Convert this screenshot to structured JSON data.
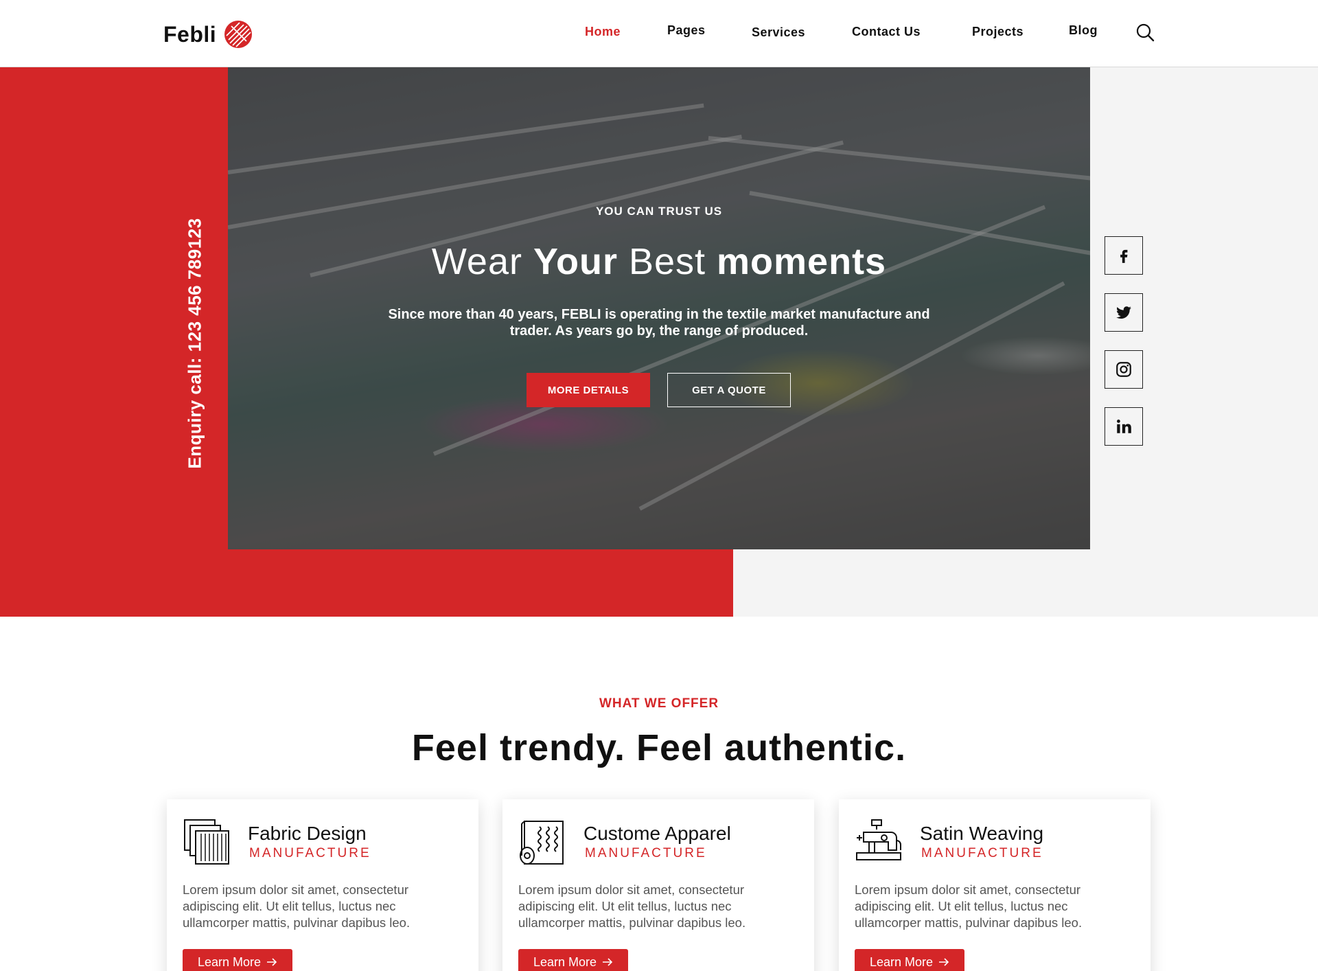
{
  "brand": {
    "name": "Febli",
    "accent": "#d42628"
  },
  "nav": {
    "items": [
      {
        "label": "Home",
        "active": true
      },
      {
        "label": "Pages",
        "active": false
      },
      {
        "label": "Services",
        "active": false
      },
      {
        "label": "Contact Us",
        "active": false
      },
      {
        "label": "Projects",
        "active": false
      },
      {
        "label": "Blog",
        "active": false
      }
    ],
    "search_icon": "search-icon"
  },
  "hero": {
    "enquiry": "Enquiry call: 123 456 789123",
    "eyebrow": "YOU CAN TRUST US",
    "headline": {
      "w1": "Wear ",
      "w2": "Your",
      "w3": " Best ",
      "w4": "moments"
    },
    "subtext": "Since more than 40 years, FEBLI is operating in the textile market manufacture and trader. As years go by, the range of produced.",
    "primary_button": "MORE DETAILS",
    "secondary_button": "GET A QUOTE"
  },
  "social": [
    "facebook-icon",
    "twitter-icon",
    "instagram-icon",
    "linkedin-icon"
  ],
  "offer": {
    "eyebrow": "WHAT WE OFFER",
    "title": "Feel trendy. Feel authentic.",
    "cards": [
      {
        "icon": "fabric-swatch-icon",
        "title": "Fabric Design",
        "subtitle": "MANUFACTURE",
        "text": "Lorem ipsum dolor sit amet, consectetur adipiscing elit. Ut elit tellus, luctus nec ullamcorper mattis, pulvinar dapibus leo.",
        "button": "Learn More"
      },
      {
        "icon": "fabric-roll-icon",
        "title": "Custome Apparel",
        "subtitle": "MANUFACTURE",
        "text": "Lorem ipsum dolor sit amet, consectetur adipiscing elit. Ut elit tellus, luctus nec ullamcorper mattis, pulvinar dapibus leo.",
        "button": "Learn More"
      },
      {
        "icon": "sewing-machine-icon",
        "title": "Satin Weaving",
        "subtitle": "MANUFACTURE",
        "text": "Lorem ipsum dolor sit amet, consectetur adipiscing elit. Ut elit tellus, luctus nec ullamcorper mattis, pulvinar dapibus leo.",
        "button": "Learn More"
      }
    ]
  }
}
